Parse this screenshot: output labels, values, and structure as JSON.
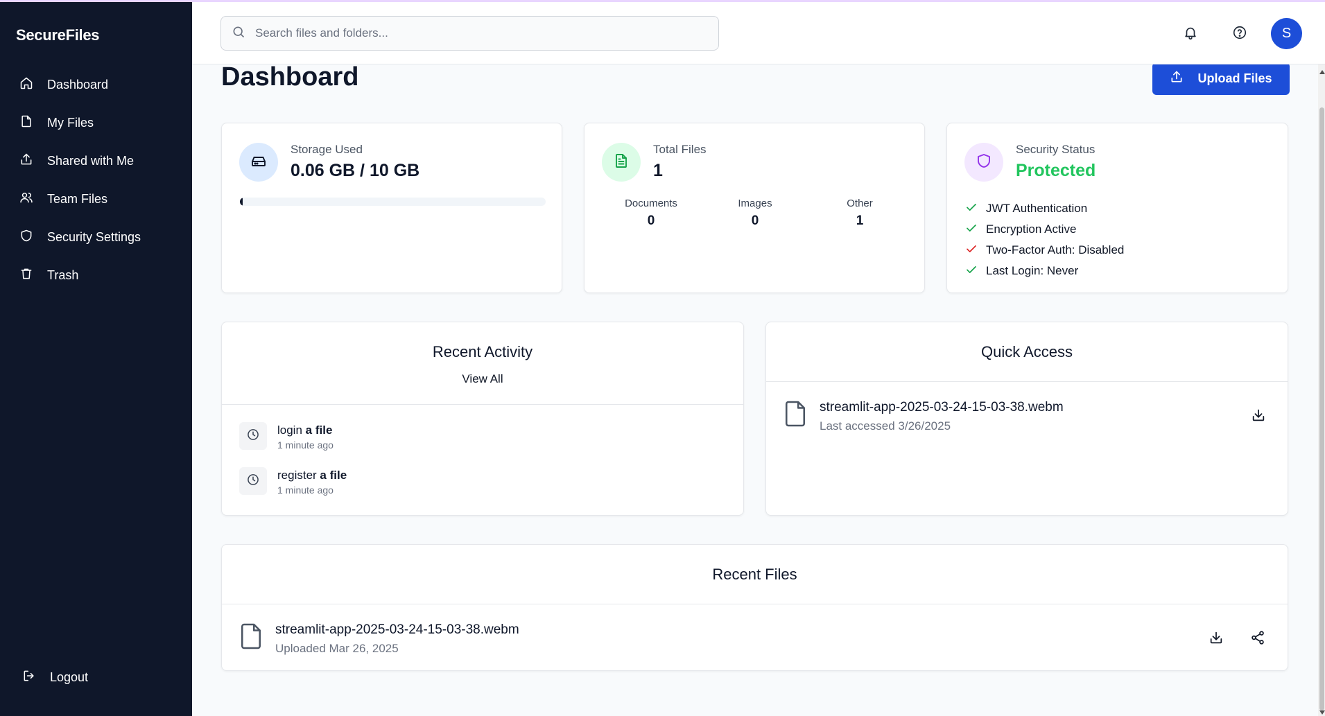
{
  "app": {
    "brand": "SecureFiles"
  },
  "sidebar": {
    "items": [
      {
        "label": "Dashboard",
        "icon": "home-icon"
      },
      {
        "label": "My Files",
        "icon": "file-icon"
      },
      {
        "label": "Shared with Me",
        "icon": "share-upload-icon"
      },
      {
        "label": "Team Files",
        "icon": "users-icon"
      },
      {
        "label": "Security Settings",
        "icon": "shield-icon"
      },
      {
        "label": "Trash",
        "icon": "trash-icon"
      }
    ],
    "logout_label": "Logout"
  },
  "header": {
    "search_placeholder": "Search files and folders...",
    "avatar_initial": "S"
  },
  "main": {
    "title": "Dashboard",
    "upload_label": "Upload Files"
  },
  "storage": {
    "label": "Storage Used",
    "value": "0.06 GB / 10 GB",
    "used_fraction": 0.006
  },
  "total_files": {
    "label": "Total Files",
    "value": "1",
    "breakdown": [
      {
        "name": "Documents",
        "value": "0"
      },
      {
        "name": "Images",
        "value": "0"
      },
      {
        "name": "Other",
        "value": "1"
      }
    ]
  },
  "security": {
    "label": "Security Status",
    "value": "Protected",
    "items": [
      {
        "text": "JWT Authentication",
        "ok": true
      },
      {
        "text": "Encryption Active",
        "ok": true
      },
      {
        "text": "Two-Factor Auth: Disabled",
        "ok": false
      },
      {
        "text": "Last Login: Never",
        "ok": true
      }
    ]
  },
  "recent_activity": {
    "title": "Recent Activity",
    "view_all": "View All",
    "items": [
      {
        "action": "login",
        "suffix": "a file",
        "time": "1 minute ago"
      },
      {
        "action": "register",
        "suffix": "a file",
        "time": "1 minute ago"
      }
    ]
  },
  "quick_access": {
    "title": "Quick Access",
    "items": [
      {
        "name": "streamlit-app-2025-03-24-15-03-38.webm",
        "sub": "Last accessed 3/26/2025"
      }
    ]
  },
  "recent_files": {
    "title": "Recent Files",
    "items": [
      {
        "name": "streamlit-app-2025-03-24-15-03-38.webm",
        "sub": "Uploaded Mar 26, 2025"
      }
    ]
  },
  "colors": {
    "sidebar_bg": "#0f172a",
    "accent": "#1d4ed8",
    "success": "#16a34a",
    "danger": "#dc2626",
    "storage_circle": "#dbeafe",
    "files_circle": "#dcfce7",
    "security_circle": "#f3e8ff"
  }
}
